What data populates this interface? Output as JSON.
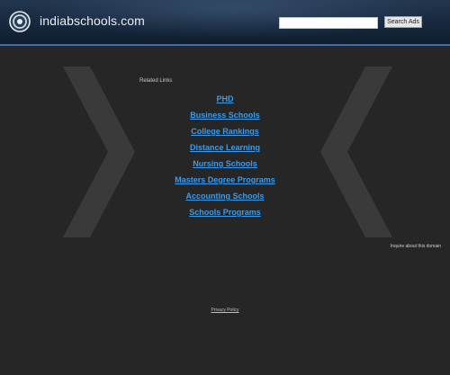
{
  "header": {
    "site_name": "indiabschools.com",
    "search_placeholder": "",
    "search_button_label": "Search Ads"
  },
  "related_links": {
    "label": "Related Links",
    "items": [
      {
        "label": "PHD"
      },
      {
        "label": "Business Schools"
      },
      {
        "label": "College Rankings"
      },
      {
        "label": "Distance Learning"
      },
      {
        "label": "Nursing Schools"
      },
      {
        "label": "Masters Degree Programs"
      },
      {
        "label": "Accounting Schools"
      },
      {
        "label": "Schools Programs"
      }
    ]
  },
  "inquire_text": "Inquire about this domain",
  "footer": {
    "privacy_label": "Privacy Policy"
  },
  "colors": {
    "background": "#262626",
    "header": "#17283d",
    "accent_line": "#3f6fb0",
    "link": "#3c9bea"
  },
  "icons": {
    "logo": "circle-logo-icon",
    "decor_left": "chevron-left-icon",
    "decor_right": "chevron-right-icon"
  }
}
